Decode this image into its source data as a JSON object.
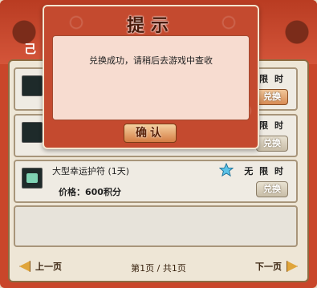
{
  "shop": {
    "title_partial": "己",
    "items": [
      {
        "limit_label": "限 时",
        "exchange_label": "兑换",
        "icon": "item-icon"
      },
      {
        "limit_label": "限 时",
        "exchange_label": "兑换",
        "icon": "item-icon"
      },
      {
        "name": "大型幸运护符 (1天)",
        "limit_label": "无 限 时",
        "price": "价格：600积分",
        "exchange_label": "兑换",
        "icon": "amulet-icon"
      }
    ],
    "pager": {
      "prev_label": "上一页",
      "next_label": "下一页",
      "page_info": "第1页 / 共1页"
    }
  },
  "dialog": {
    "title": "提示",
    "message": "兑换成功，请稍后去游戏中查收",
    "confirm_label": "确认"
  }
}
